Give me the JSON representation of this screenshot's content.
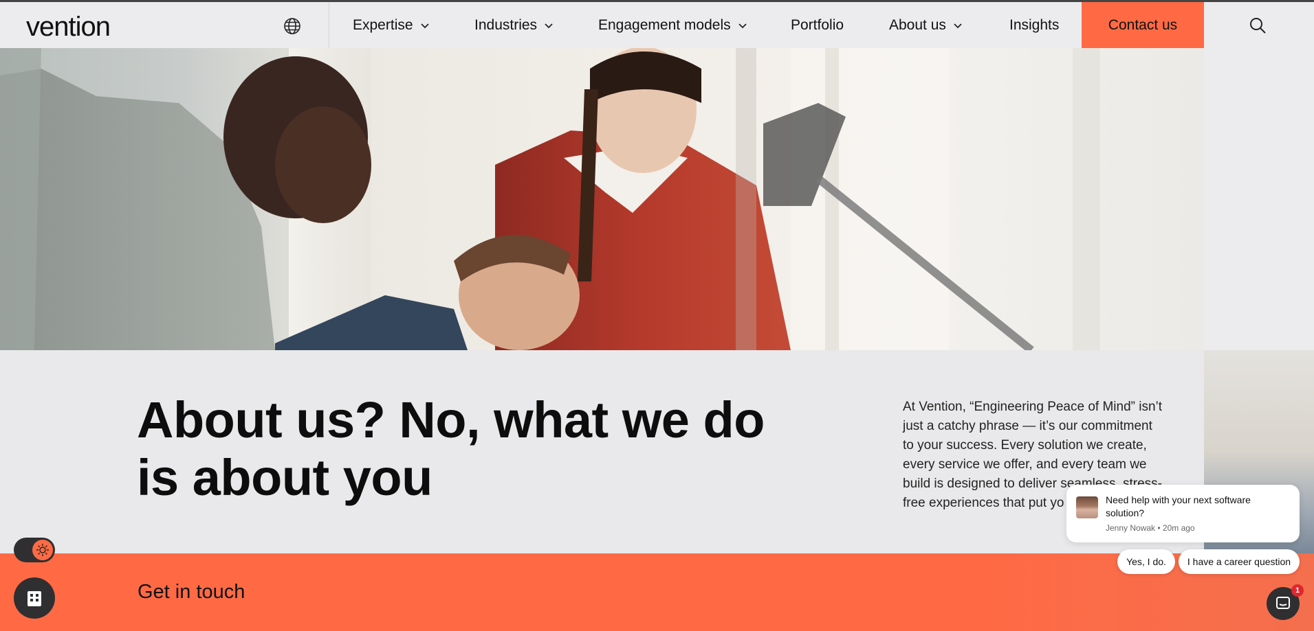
{
  "brand": {
    "logo_text": "vention",
    "accent": "#ff6a45"
  },
  "nav": {
    "globe_icon": "globe-icon",
    "items": [
      {
        "label": "Expertise",
        "has_dropdown": true
      },
      {
        "label": "Industries",
        "has_dropdown": true
      },
      {
        "label": "Engagement models",
        "has_dropdown": true
      },
      {
        "label": "Portfolio",
        "has_dropdown": false
      },
      {
        "label": "About us",
        "has_dropdown": true
      },
      {
        "label": "Insights",
        "has_dropdown": false
      }
    ],
    "contact_label": "Contact us",
    "search_icon": "search-icon"
  },
  "hero": {
    "image": "team-working-photo"
  },
  "content": {
    "headline": "About us? No, what we do is about you",
    "body": "At Vention, “Engineering Peace of Mind” isn’t just a catchy phrase — it’s our commitment to your success. Every solution we create, every service we offer, and every team we build is designed to deliver seamless, stress-free experiences that put yo"
  },
  "get_in_touch": {
    "title": "Get in touch"
  },
  "chat": {
    "message": "Need help with your next software solution?",
    "meta": "Jenny Nowak • 20m ago",
    "reply_yes": "Yes, I do.",
    "reply_career": "I have a career question",
    "badge_count": "1"
  }
}
